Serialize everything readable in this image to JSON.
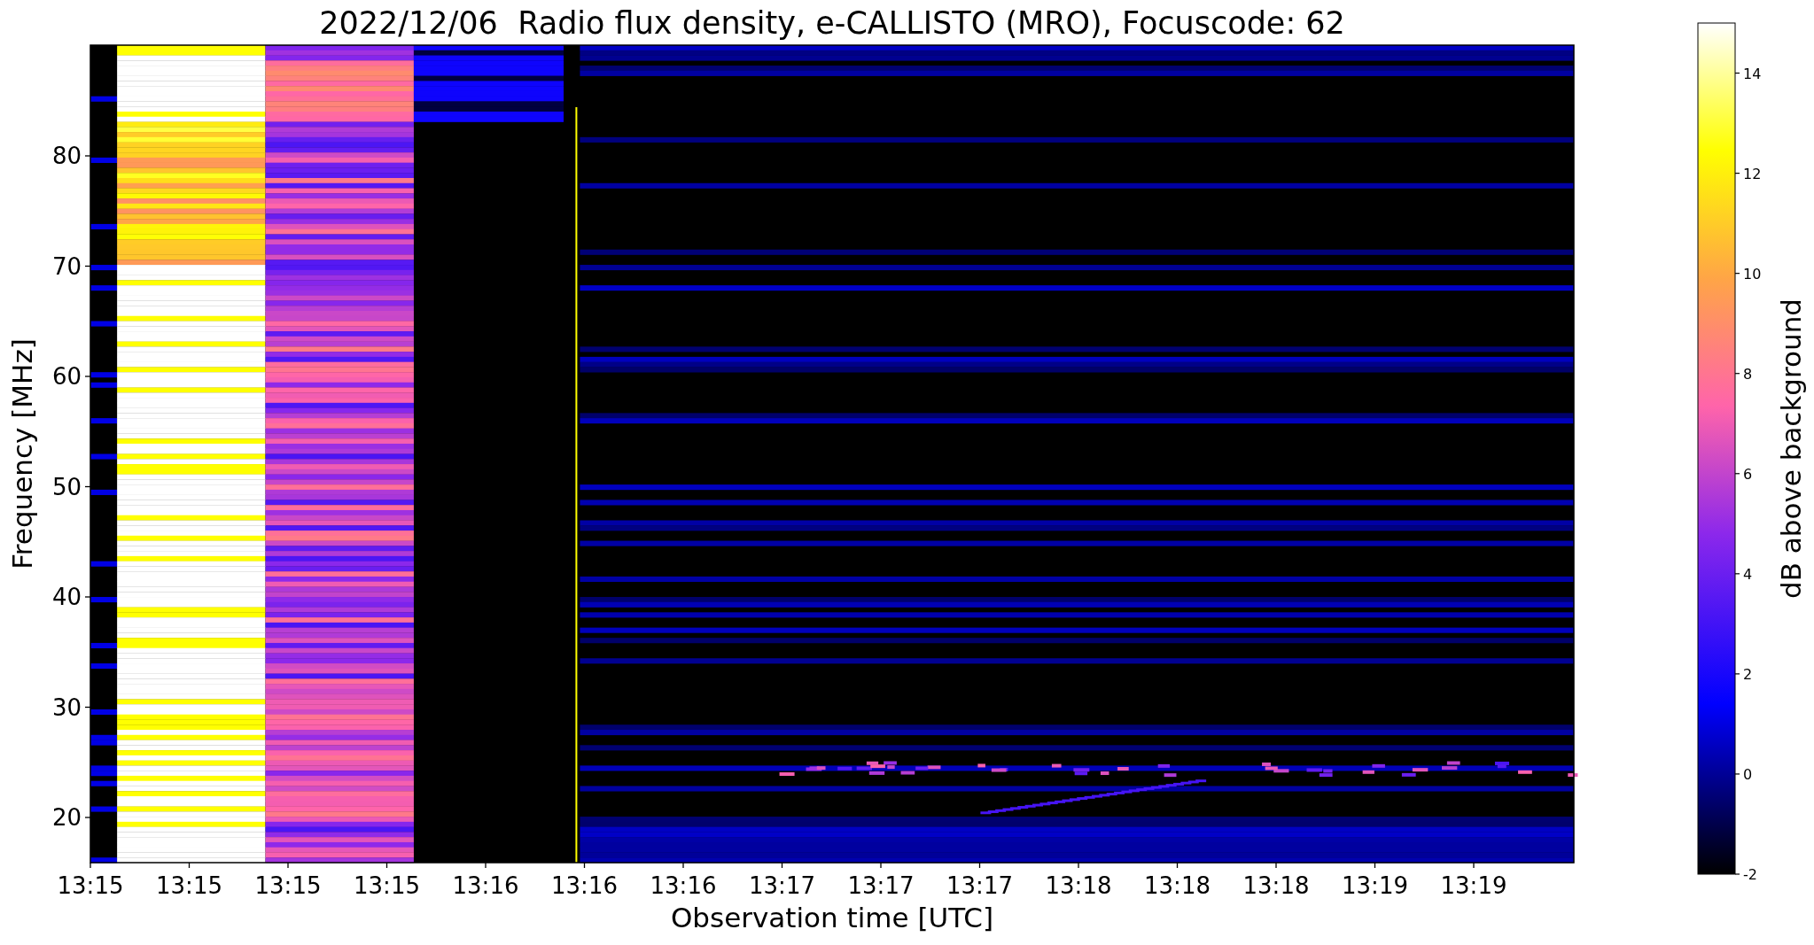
{
  "title": "2022/12/06  Radio flux density, e-CALLISTO (MRO), Focuscode: 62",
  "y_axis": {
    "label": "Frequency [MHz]",
    "ticks": [
      "80",
      "70",
      "60",
      "50",
      "40",
      "30",
      "20"
    ]
  },
  "x_axis": {
    "label": "Observation time [UTC]",
    "ticks": [
      "13:15",
      "13:15",
      "13:15",
      "13:15",
      "13:16",
      "13:16",
      "13:16",
      "13:17",
      "13:17",
      "13:17",
      "13:18",
      "13:18",
      "13:18",
      "13:19",
      "13:19"
    ]
  },
  "colorbar": {
    "label": "dB above background",
    "ticks": [
      "14",
      "12",
      "10",
      "8",
      "6",
      "4",
      "2",
      "0",
      "-2"
    ]
  }
}
